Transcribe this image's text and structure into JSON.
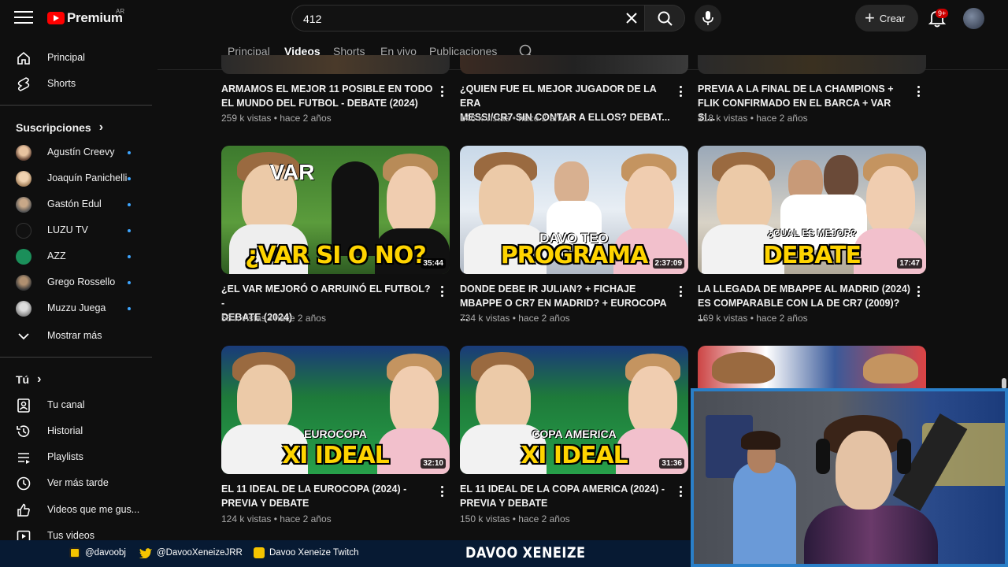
{
  "header": {
    "logo_text": "Premium",
    "country": "AR",
    "search_value": "412",
    "create_label": "Crear",
    "notif_count": "9+"
  },
  "sidebar": {
    "main": [
      {
        "label": "Principal",
        "icon": "home-icon"
      },
      {
        "label": "Shorts",
        "icon": "shorts-icon"
      }
    ],
    "subs_header": "Suscripciones",
    "subs_chevron": "›",
    "subscriptions": [
      {
        "label": "Agustín Creevy",
        "color": "#b08a6a"
      },
      {
        "label": "Joaquín Panichelli",
        "color": "#c9a27c"
      },
      {
        "label": "Gastón Edul",
        "color": "#8a7a6a"
      },
      {
        "label": "LUZU TV",
        "color": "#111111"
      },
      {
        "label": "AZZ",
        "color": "#1b8f5a"
      },
      {
        "label": "Grego Rossello",
        "color": "#7a6a5a"
      },
      {
        "label": "Muzzu Juega",
        "color": "#9a9a9a"
      }
    ],
    "more_label": "Mostrar más",
    "you_header": "Tú",
    "you_chevron": "›",
    "you": [
      {
        "label": "Tu canal",
        "icon": "channel-icon"
      },
      {
        "label": "Historial",
        "icon": "history-icon"
      },
      {
        "label": "Playlists",
        "icon": "playlists-icon"
      },
      {
        "label": "Ver más tarde",
        "icon": "watch-later-icon"
      },
      {
        "label": "Videos que me gus...",
        "icon": "like-icon"
      },
      {
        "label": "Tus videos",
        "icon": "your-videos-icon"
      }
    ]
  },
  "tabs": [
    "Principal",
    "Videos",
    "Shorts",
    "En vivo",
    "Publicaciones"
  ],
  "active_tab": "Videos",
  "videos_top": [
    {
      "title1": "ARMAMOS EL MEJOR 11 POSIBLE EN TODO",
      "title2": "EL MUNDO DEL FUTBOL - DEBATE (2024)",
      "meta": "259 k vistas • hace 2 años"
    },
    {
      "title1": "¿QUIEN FUE EL MEJOR JUGADOR DE LA ERA",
      "title2": "MESSI/CR7 SIN CONTAR A ELLOS? DEBAT...",
      "meta": "146 k vistas • hace 2 años"
    },
    {
      "title1": "PREVIA A LA FINAL DE LA CHAMPIONS +",
      "title2": "FLIK CONFIRMADO EN EL BARCA + VAR SI...",
      "meta": "218 k vistas • hace 2 años"
    }
  ],
  "videos_mid": [
    {
      "title1": "¿EL VAR MEJORÓ O ARRUINÓ EL FUTBOL? -",
      "title2": "DEBATE (2024)",
      "meta": "53 k vistas • hace 2 años",
      "duration": "35:44",
      "thumb_big": "¿VAR SI O NO?",
      "thumb_top": "VAR"
    },
    {
      "title1": "DONDE DEBE IR JULIAN? + FICHAJE",
      "title2": "MBAPPE O CR7 EN MADRID? + EUROCOPA ...",
      "meta": "734 k vistas • hace 2 años",
      "duration": "2:37:09",
      "thumb_big": "PROGRAMA",
      "thumb_top": "DAVO TEO"
    },
    {
      "title1": "LA LLEGADA DE MBAPPE AL MADRID (2024)",
      "title2": "ES COMPARABLE CON LA DE CR7 (2009)? ...",
      "meta": "169 k vistas • hace 2 años",
      "duration": "17:47",
      "thumb_big": "DEBATE",
      "thumb_top": "¿CUAL ES MEJOR?"
    }
  ],
  "videos_bottom": [
    {
      "title1": "EL 11 IDEAL DE LA EUROCOPA (2024) -",
      "title2": "PREVIA Y DEBATE",
      "meta": "124 k vistas • hace 2 años",
      "duration": "32:10",
      "thumb_big": "XI IDEAL",
      "thumb_top": "EUROCOPA"
    },
    {
      "title1": "EL 11 IDEAL DE LA COPA AMERICA (2024) -",
      "title2": "PREVIA Y DEBATE",
      "meta": "150 k vistas • hace 2 años",
      "duration": "31:36",
      "thumb_big": "XI IDEAL",
      "thumb_top": "COPA AMERICA"
    }
  ],
  "overlay": {
    "instagram": "@davoobj",
    "twitter": "@DavooXeneizeJRR",
    "twitch": "Davoo Xeneize Twitch",
    "brand": "DAVOO XENEIZE"
  },
  "colors": {
    "accent": "#3ea6ff",
    "brand_red": "#ff0000",
    "footer": "#071a33",
    "webcam_border": "#2a7fc8"
  }
}
